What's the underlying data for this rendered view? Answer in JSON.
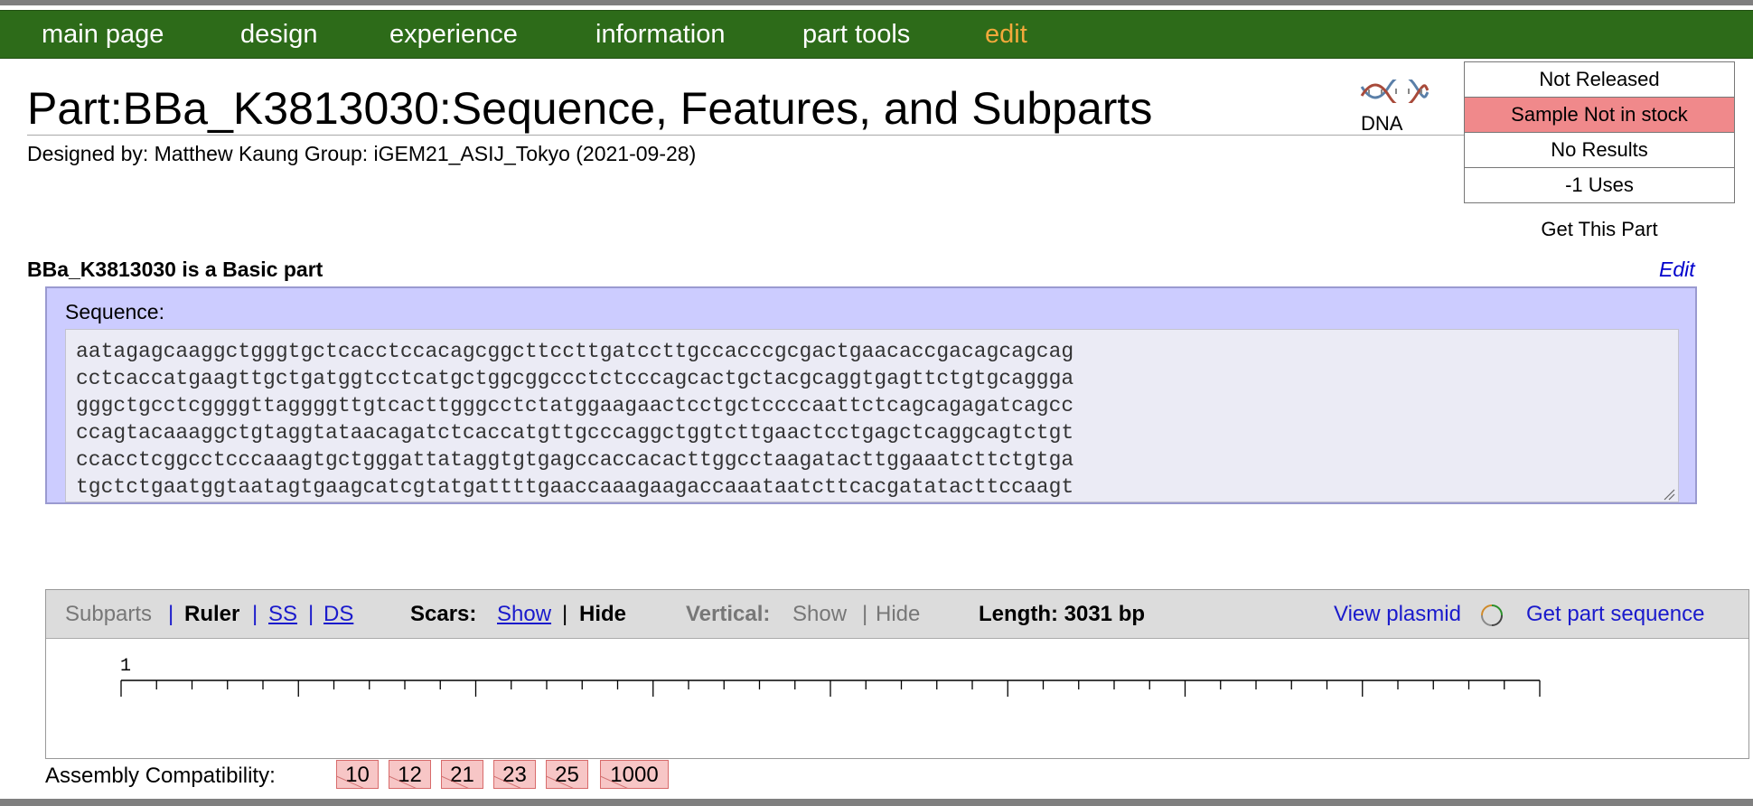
{
  "nav": {
    "items": [
      {
        "label": "main page"
      },
      {
        "label": "design"
      },
      {
        "label": "experience"
      },
      {
        "label": "information"
      },
      {
        "label": "part tools"
      },
      {
        "label": "edit"
      }
    ],
    "active_color": "#f3a93b",
    "bar_color": "#2d6b19"
  },
  "header": {
    "title": "Part:BBa_K3813030:Sequence, Features, and Subparts",
    "designed_by": "Designed by: Matthew Kaung   Group: iGEM21_ASIJ_Tokyo   (2021-09-28)",
    "type_label": "DNA",
    "type_icon": "dna-helix-icon"
  },
  "status": {
    "items": [
      "Not Released",
      "Sample Not in stock",
      "No Results",
      "-1 Uses"
    ],
    "warn_color": "#f0898b",
    "get_part": "Get This Part"
  },
  "part": {
    "heading": "BBa_K3813030 is a Basic part",
    "edit": "Edit"
  },
  "sequence": {
    "label": "Sequence:",
    "text": "aatagagcaaggctgggtgctcacctccacagcggcttccttgatccttgccacccgcgactgaacaccgacagcagcag\ncctcaccatgaagttgctgatggtcctcatgctggcggccctctcccagcactgctacgcaggtgagttctgtgcaggga\ngggctgcctcggggttaggggttgtcacttgggcctctatggaagaactcctgctccccaattctcagcagagatcagcc\nccagtacaaaggctgtaggtataacagatctcaccatgttgcccaggctggtcttgaactcctgagctcaggcagtctgt\nccacctcggcctcccaaagtgctgggattataggtgtgagccaccacacttggcctaagatacttggaaatcttctgtga\ntgctctgaatggtaatagtgaagcatcgtatgattttgaaccaaagaagaccaaataatcttcacgatatacttccaagt"
  },
  "viewer": {
    "subparts": "Subparts",
    "ruler": "Ruler",
    "ss": "SS",
    "ds": "DS",
    "sep": "|",
    "scars_label": "Scars:",
    "scars_show": "Show",
    "scars_hide": "Hide",
    "vertical_label": "Vertical:",
    "vertical_show": "Show",
    "vertical_hide": "Hide",
    "length": "Length: 3031 bp",
    "view_plasmid": "View plasmid",
    "get_sequence": "Get part sequence",
    "ruler_start": "1",
    "ruler_ticks": 41,
    "ruler_major_every": 5
  },
  "assembly": {
    "label": "Assembly Compatibility:",
    "standards": [
      "10",
      "12",
      "21",
      "23",
      "25",
      "1000"
    ],
    "badge_color": "#f7c6c6"
  }
}
